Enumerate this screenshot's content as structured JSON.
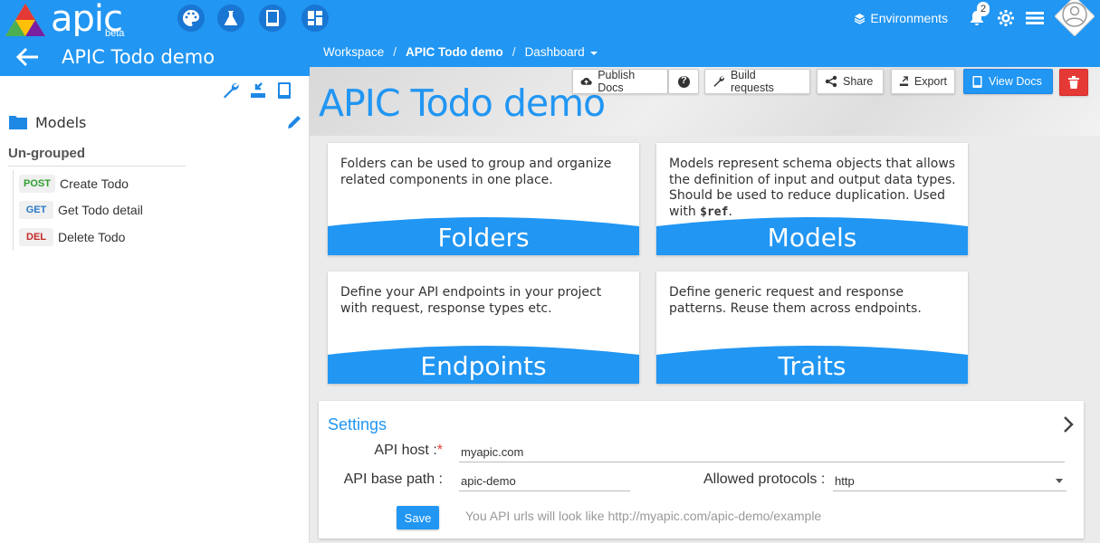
{
  "app": {
    "name": "apic",
    "tag": "beta"
  },
  "topbar": {
    "environments_label": "Environments",
    "notifications_count": "2"
  },
  "left": {
    "title": "APIC Todo demo",
    "models_label": "Models",
    "group_label": "Un-grouped",
    "endpoints": [
      {
        "method": "POST",
        "label": "Create Todo"
      },
      {
        "method": "GET",
        "label": "Get Todo detail"
      },
      {
        "method": "DEL",
        "label": "Delete Todo"
      }
    ]
  },
  "breadcrumb": {
    "workspace": "Workspace",
    "project": "APIC Todo demo",
    "page": "Dashboard",
    "sep": "/"
  },
  "hero": {
    "title": "APIC Todo demo"
  },
  "toolbar": {
    "publish": "Publish Docs",
    "help": "?",
    "build": "Build requests",
    "share": "Share",
    "export": "Export",
    "view": "View Docs"
  },
  "cards": {
    "folders": {
      "text": "Folders can be used to group and organize related components in one place.",
      "title": "Folders"
    },
    "models": {
      "text_before": "Models represent schema objects that allows the definition of input and output data types. Should be used to reduce duplication. Used with ",
      "code": "$ref",
      "text_after": ".",
      "title": "Models"
    },
    "endpoints": {
      "text": "Define your API endpoints in your project with request, response types etc.",
      "title": "Endpoints"
    },
    "traits": {
      "text": "Define generic request and response patterns. Reuse them across endpoints.",
      "title": "Traits"
    }
  },
  "settings": {
    "title": "Settings",
    "host_label": "API host :",
    "host_required": "*",
    "host_value": "myapic.com",
    "base_label": "API base path :",
    "base_value": "apic-demo",
    "protocols_label": "Allowed protocols :",
    "protocols_value": "http",
    "save": "Save",
    "hint": "You API urls will look like http://myapic.com/apic-demo/example"
  },
  "colors": {
    "primary": "#2196f3",
    "danger": "#e53935",
    "post": "#2e9e2e",
    "get": "#2979c9",
    "del": "#c62828"
  }
}
